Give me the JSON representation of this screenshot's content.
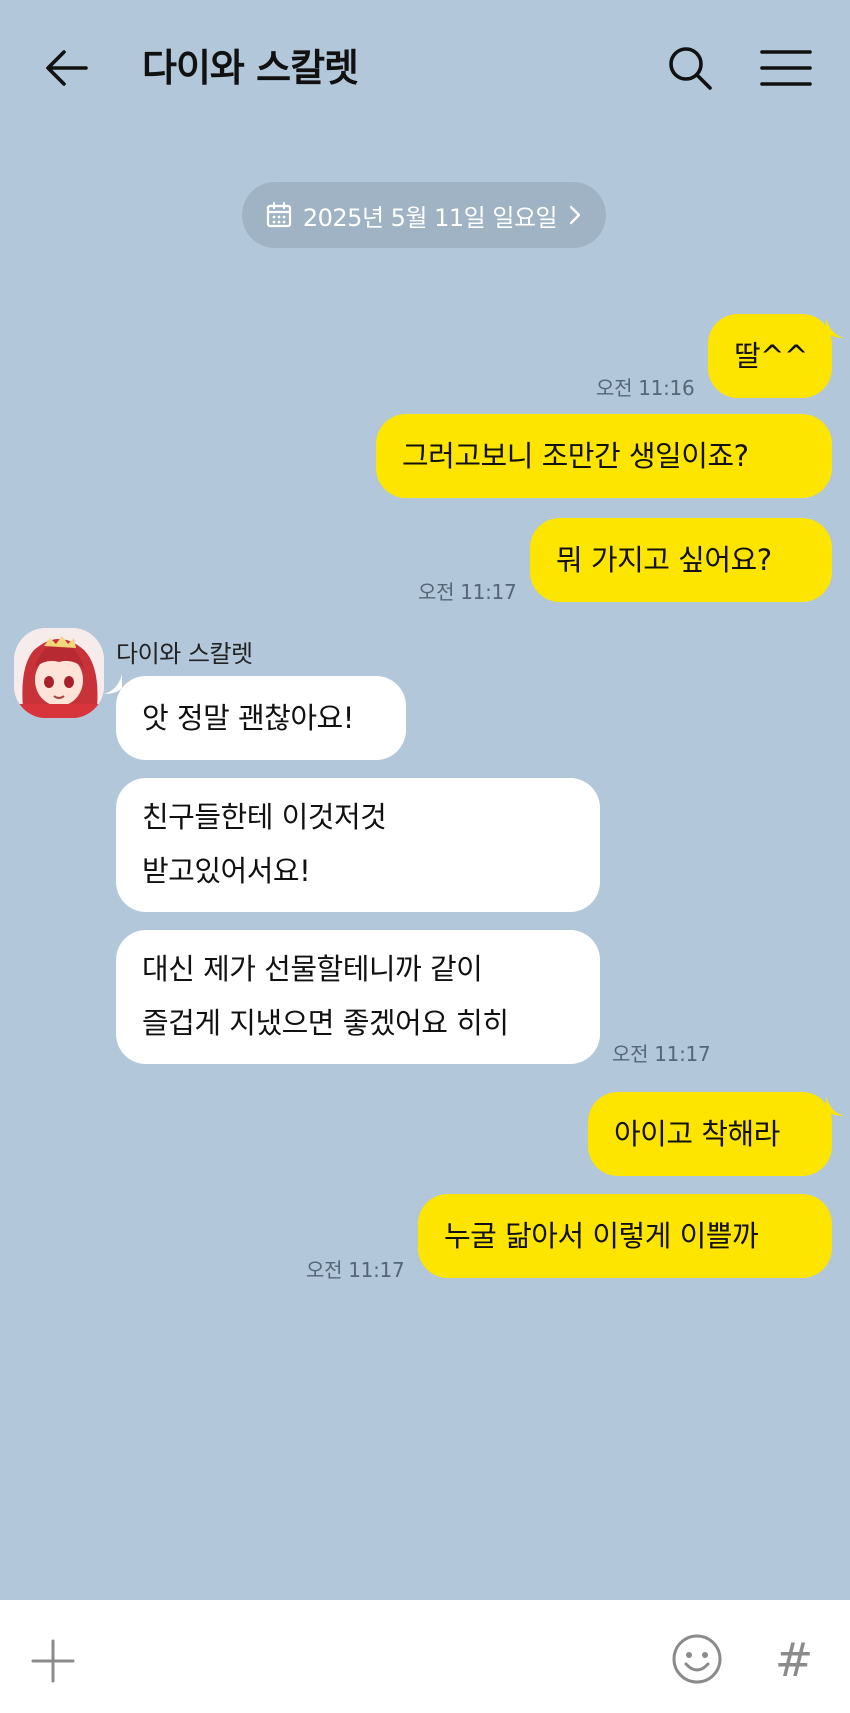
{
  "header": {
    "title": "다이와 스칼렛",
    "back_icon": "arrow-left-icon",
    "search_icon": "search-icon",
    "menu_icon": "hamburger-menu-icon"
  },
  "date_divider": {
    "label": "2025년 5월 11일 일요일",
    "icon": "calendar-icon",
    "chevron": "chevron-right-icon"
  },
  "messages": {
    "m1": {
      "text": "딸^^",
      "time": "오전 11:16"
    },
    "m2": {
      "text": "그러고보니 조만간 생일이죠?"
    },
    "m3": {
      "text": "뭐 가지고 싶어요?",
      "time": "오전 11:17"
    },
    "sender": {
      "name": "다이와 스칼렛"
    },
    "m4": {
      "text": "앗 정말 괜찮아요!"
    },
    "m5": {
      "line1": "친구들한테 이것저것",
      "line2": "받고있어서요!"
    },
    "m6": {
      "line1": "대신 제가 선물할테니까 같이",
      "line2": "즐겁게 지냈으면 좋겠어요 히히",
      "time": "오전 11:17"
    },
    "m7": {
      "text": "아이고 착해라"
    },
    "m8": {
      "text": "누굴 닮아서 이렇게 이쁠까",
      "time": "오전 11:17"
    }
  },
  "input_bar": {
    "plus_icon": "plus-icon",
    "emoji_icon": "emoji-icon",
    "hash_label": "#"
  },
  "colors": {
    "background": "#b2c7d9",
    "my_bubble": "#fee500",
    "their_bubble": "#ffffff",
    "date_pill": "#9fb3c4"
  }
}
